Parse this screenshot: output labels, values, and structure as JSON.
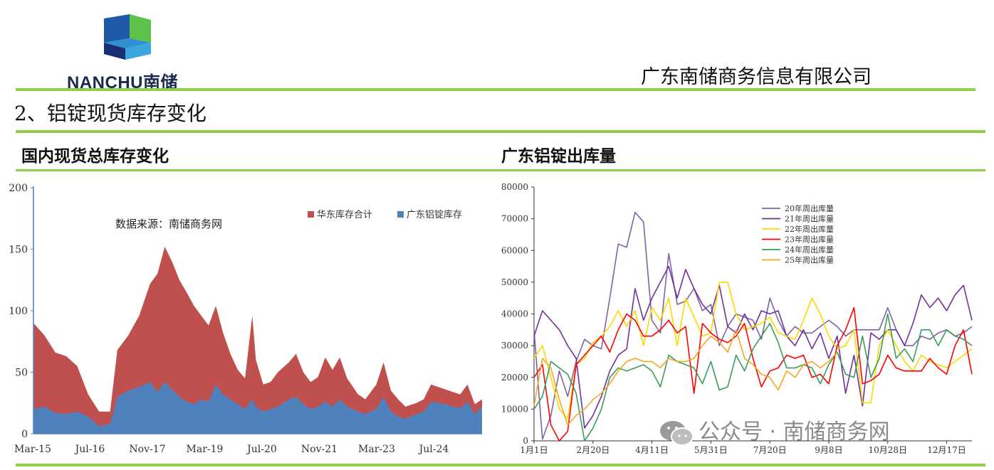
{
  "header": {
    "logo_text": "NANCHU南储",
    "company_name": "广东南储商务信息有限公司"
  },
  "section_title": "2、铝锭现货库存变化",
  "left_panel": {
    "title": "国内现货总库存变化"
  },
  "right_panel": {
    "title": "广东铝锭出库量"
  },
  "watermark": "公众号 · 南储商务网",
  "colors": {
    "green_rule": "#8fcf4a",
    "huadong": "#c0504d",
    "guangdong": "#4f81bd",
    "s20": "#8064a2",
    "s21": "#7030a0",
    "s22": "#ffd700",
    "s23": "#ff0000",
    "s24": "#3c9c5c",
    "s25": "#f5a623"
  },
  "chart_data": [
    {
      "type": "area",
      "source_note": "数据来源：南储商务网",
      "ylim": [
        0,
        200
      ],
      "yticks": [
        0,
        50,
        100,
        150,
        200
      ],
      "xticks": [
        "Mar-15",
        "Jul-16",
        "Nov-17",
        "Mar-19",
        "Jul-20",
        "Nov-21",
        "Mar-23",
        "Jul-24"
      ],
      "x_range": [
        "2015-03",
        "2025-06"
      ],
      "series": [
        {
          "name": "华东库存合计",
          "color": "#c0504d",
          "points": [
            [
              "2015-03",
              90
            ],
            [
              "2015-06",
              80
            ],
            [
              "2015-09",
              66
            ],
            [
              "2015-12",
              63
            ],
            [
              "2016-03",
              55
            ],
            [
              "2016-06",
              32
            ],
            [
              "2016-09",
              18
            ],
            [
              "2016-12",
              18
            ],
            [
              "2017-02",
              68
            ],
            [
              "2017-05",
              80
            ],
            [
              "2017-08",
              96
            ],
            [
              "2017-11",
              122
            ],
            [
              "2018-01",
              130
            ],
            [
              "2018-03",
              152
            ],
            [
              "2018-05",
              140
            ],
            [
              "2018-07",
              125
            ],
            [
              "2018-09",
              115
            ],
            [
              "2018-11",
              104
            ],
            [
              "2019-01",
              96
            ],
            [
              "2019-03",
              88
            ],
            [
              "2019-05",
              104
            ],
            [
              "2019-07",
              82
            ],
            [
              "2019-09",
              65
            ],
            [
              "2019-11",
              52
            ],
            [
              "2020-01",
              45
            ],
            [
              "2020-03",
              96
            ],
            [
              "2020-04",
              60
            ],
            [
              "2020-06",
              40
            ],
            [
              "2020-08",
              42
            ],
            [
              "2020-10",
              50
            ],
            [
              "2021-01",
              58
            ],
            [
              "2021-03",
              65
            ],
            [
              "2021-05",
              50
            ],
            [
              "2021-07",
              42
            ],
            [
              "2021-09",
              46
            ],
            [
              "2021-11",
              62
            ],
            [
              "2022-01",
              52
            ],
            [
              "2022-03",
              62
            ],
            [
              "2022-05",
              45
            ],
            [
              "2022-08",
              32
            ],
            [
              "2022-10",
              28
            ],
            [
              "2023-01",
              40
            ],
            [
              "2023-03",
              58
            ],
            [
              "2023-05",
              35
            ],
            [
              "2023-07",
              28
            ],
            [
              "2023-09",
              22
            ],
            [
              "2023-12",
              25
            ],
            [
              "2024-02",
              28
            ],
            [
              "2024-04",
              40
            ],
            [
              "2024-06",
              38
            ],
            [
              "2024-08",
              36
            ],
            [
              "2024-10",
              34
            ],
            [
              "2024-12",
              32
            ],
            [
              "2025-02",
              40
            ],
            [
              "2025-04",
              24
            ],
            [
              "2025-06",
              28
            ]
          ]
        },
        {
          "name": "广东铝锭库存",
          "color": "#4f81bd",
          "points": [
            [
              "2015-03",
              20
            ],
            [
              "2015-06",
              22
            ],
            [
              "2015-09",
              17
            ],
            [
              "2015-12",
              16
            ],
            [
              "2016-03",
              18
            ],
            [
              "2016-06",
              14
            ],
            [
              "2016-09",
              6
            ],
            [
              "2016-12",
              8
            ],
            [
              "2017-02",
              30
            ],
            [
              "2017-05",
              35
            ],
            [
              "2017-08",
              38
            ],
            [
              "2017-11",
              42
            ],
            [
              "2018-01",
              34
            ],
            [
              "2018-03",
              42
            ],
            [
              "2018-05",
              36
            ],
            [
              "2018-07",
              30
            ],
            [
              "2018-09",
              26
            ],
            [
              "2018-11",
              24
            ],
            [
              "2019-01",
              28
            ],
            [
              "2019-03",
              26
            ],
            [
              "2019-05",
              40
            ],
            [
              "2019-07",
              32
            ],
            [
              "2019-09",
              28
            ],
            [
              "2019-11",
              24
            ],
            [
              "2020-01",
              20
            ],
            [
              "2020-03",
              28
            ],
            [
              "2020-04",
              22
            ],
            [
              "2020-06",
              18
            ],
            [
              "2020-08",
              20
            ],
            [
              "2020-10",
              22
            ],
            [
              "2021-01",
              28
            ],
            [
              "2021-03",
              30
            ],
            [
              "2021-05",
              24
            ],
            [
              "2021-07",
              20
            ],
            [
              "2021-09",
              22
            ],
            [
              "2021-11",
              26
            ],
            [
              "2022-01",
              22
            ],
            [
              "2022-03",
              28
            ],
            [
              "2022-05",
              22
            ],
            [
              "2022-08",
              18
            ],
            [
              "2022-10",
              16
            ],
            [
              "2023-01",
              20
            ],
            [
              "2023-03",
              30
            ],
            [
              "2023-05",
              18
            ],
            [
              "2023-07",
              14
            ],
            [
              "2023-09",
              12
            ],
            [
              "2023-12",
              16
            ],
            [
              "2024-02",
              18
            ],
            [
              "2024-04",
              26
            ],
            [
              "2024-06",
              25
            ],
            [
              "2024-08",
              24
            ],
            [
              "2024-10",
              22
            ],
            [
              "2024-12",
              21
            ],
            [
              "2025-02",
              26
            ],
            [
              "2025-04",
              16
            ],
            [
              "2025-06",
              22
            ]
          ]
        }
      ]
    },
    {
      "type": "line",
      "ylim": [
        0,
        80000
      ],
      "yticks": [
        0,
        10000,
        20000,
        30000,
        40000,
        50000,
        60000,
        70000,
        80000
      ],
      "xticks": [
        "1月1日",
        "2月20日",
        "4月11日",
        "5月31日",
        "7月20日",
        "9月8日",
        "10月28日",
        "12月17日"
      ],
      "x_week_range": [
        1,
        53
      ],
      "series": [
        {
          "name": "20年周出库量",
          "color": "#8064a2",
          "values": [
            35000,
            500,
            8000,
            22000,
            14000,
            25000,
            32000,
            30000,
            29000,
            45000,
            62000,
            61000,
            72000,
            69000,
            38000,
            34000,
            59000,
            43000,
            44000,
            48000,
            41000,
            43000,
            30000,
            36000,
            40000,
            39000,
            38000,
            32000,
            45000,
            38000,
            33000,
            36000,
            34000,
            34000,
            36000,
            38000,
            36000,
            33000,
            35000,
            35000,
            35000,
            35000,
            42000,
            35000,
            30000,
            30000,
            33000,
            32000,
            34000,
            35000,
            33000,
            34000,
            36000
          ]
        },
        {
          "name": "21年周出库量",
          "color": "#7030a0",
          "values": [
            33000,
            41000,
            38000,
            35000,
            30000,
            26000,
            4000,
            8000,
            14000,
            22000,
            27000,
            29000,
            48000,
            38000,
            45000,
            50000,
            55000,
            45000,
            54000,
            48000,
            43000,
            40000,
            49000,
            36000,
            34000,
            40000,
            35000,
            41000,
            40000,
            41000,
            33000,
            30000,
            35000,
            29000,
            34000,
            26000,
            33000,
            15000,
            27000,
            11000,
            34000,
            32000,
            35000,
            35000,
            30000,
            37000,
            46000,
            42000,
            45000,
            41000,
            46000,
            49000,
            38000
          ]
        },
        {
          "name": "22年周出库量",
          "color": "#ffd700",
          "values": [
            26000,
            30000,
            20000,
            10000,
            7000,
            24000,
            26000,
            31000,
            33000,
            36000,
            41000,
            36000,
            41000,
            30000,
            42000,
            38000,
            45000,
            30000,
            45000,
            39000,
            33000,
            34000,
            50000,
            50000,
            40000,
            35000,
            36000,
            37000,
            39000,
            34000,
            33000,
            32000,
            38000,
            45000,
            40000,
            33000,
            29000,
            30000,
            35000,
            12000,
            12000,
            30000,
            35000,
            30000,
            25000,
            22000,
            27000,
            25000,
            24000,
            23000,
            25000,
            27000,
            29000
          ]
        },
        {
          "name": "23年周出库量",
          "color": "#ff0000",
          "values": [
            20000,
            24000,
            5000,
            0,
            3000,
            24000,
            27000,
            30000,
            33000,
            28000,
            35000,
            40000,
            38000,
            33000,
            33000,
            35000,
            38000,
            34000,
            36000,
            15000,
            37000,
            34000,
            32000,
            31000,
            33000,
            37000,
            26000,
            17000,
            22000,
            23000,
            27000,
            26000,
            27000,
            20000,
            21000,
            18000,
            30000,
            35000,
            42000,
            18000,
            19000,
            21000,
            27000,
            23000,
            22000,
            22000,
            22000,
            26000,
            23000,
            21000,
            30000,
            35000,
            21000
          ]
        },
        {
          "name": "24年周出库量",
          "color": "#3c9c5c",
          "values": [
            10000,
            14000,
            25000,
            23000,
            21000,
            15000,
            0,
            4000,
            10000,
            20000,
            23000,
            22000,
            23000,
            24000,
            22000,
            17000,
            27000,
            25000,
            24000,
            23000,
            18000,
            25000,
            16000,
            17000,
            27000,
            22000,
            29000,
            33000,
            37000,
            31000,
            23000,
            23000,
            24000,
            23000,
            18000,
            24000,
            28000,
            21000,
            20000,
            33000,
            20000,
            26000,
            40000,
            26000,
            29000,
            25000,
            35000,
            35000,
            30000,
            35000,
            33000,
            32000,
            30000
          ]
        },
        {
          "name": "25年周出库量",
          "color": "#f5a623",
          "values": [
            11000,
            26000,
            23000,
            13000,
            5000,
            8000,
            10000,
            13000,
            15000,
            18000,
            22000,
            25000,
            26000,
            25000,
            25000,
            23000,
            26000,
            25000,
            25000,
            26000,
            30000,
            33000,
            31000,
            28000,
            35000,
            26000,
            24000,
            21000,
            20000,
            16000,
            22000,
            20000,
            24000,
            25000,
            23000,
            25000,
            28000
          ]
        }
      ]
    }
  ]
}
